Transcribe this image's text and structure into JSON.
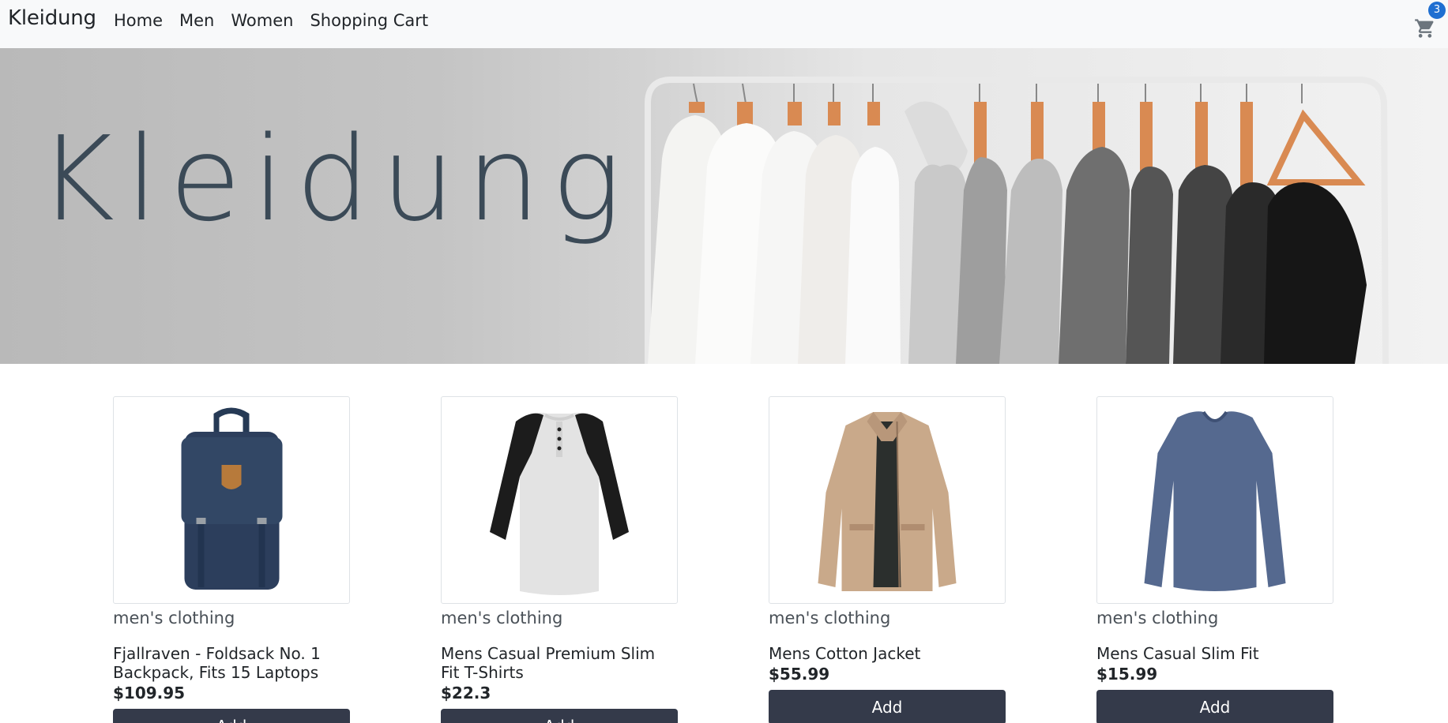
{
  "navbar": {
    "brand": "Kleidung",
    "links": [
      "Home",
      "Men",
      "Women",
      "Shopping Cart"
    ],
    "cart_count": "3",
    "cart_icon": "shopping-cart-icon",
    "badge_color": "#1f6fd1"
  },
  "hero": {
    "title": "Kleidung"
  },
  "products": [
    {
      "category": "men's clothing",
      "title": "Fjallraven - Foldsack No. 1 Backpack, Fits 15 Laptops",
      "price": "$109.95",
      "button": "Add",
      "image": "backpack-image"
    },
    {
      "category": "men's clothing",
      "title": "Mens Casual Premium Slim Fit T-Shirts",
      "price": "$22.3",
      "button": "Add",
      "image": "raglan-shirt-image"
    },
    {
      "category": "men's clothing",
      "title": "Mens Cotton Jacket",
      "price": "$55.99",
      "button": "Add",
      "image": "jacket-image"
    },
    {
      "category": "men's clothing",
      "title": "Mens Casual Slim Fit",
      "price": "$15.99",
      "button": "Add",
      "image": "long-sleeve-shirt-image"
    }
  ],
  "colors": {
    "navbar_bg": "#f8f9fa",
    "button_bg": "#343a4a",
    "hero_text": "#3b4a57"
  }
}
